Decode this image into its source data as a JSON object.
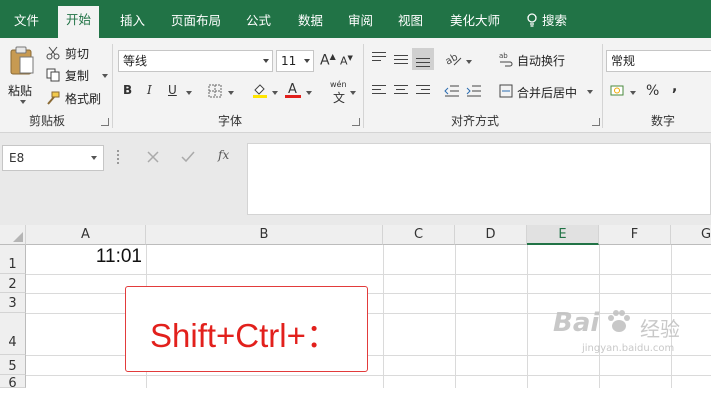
{
  "tabs": [
    "文件",
    "开始",
    "插入",
    "页面布局",
    "公式",
    "数据",
    "审阅",
    "视图",
    "美化大师"
  ],
  "search_label": "搜索",
  "clipboard": {
    "paste": "粘贴",
    "cut": "剪切",
    "copy": "复制",
    "format_painter": "格式刷",
    "group": "剪贴板"
  },
  "font": {
    "name": "等线",
    "size": "11",
    "bold": "B",
    "italic": "I",
    "underline": "U",
    "grow": "A",
    "shrink": "A",
    "color_a": "A",
    "wen": "wén",
    "wen_char": "文",
    "group": "字体"
  },
  "alignment": {
    "wrap": "自动换行",
    "merge": "合并后居中",
    "group": "对齐方式"
  },
  "number": {
    "format": "常规",
    "percent": "%",
    "comma": ",",
    "group": "数字"
  },
  "formula_bar": {
    "name_box": "E8",
    "fx": "fx"
  },
  "columns": [
    "A",
    "B",
    "C",
    "D",
    "E",
    "F",
    "G"
  ],
  "rows": [
    "1",
    "2",
    "3",
    "4",
    "5",
    "6"
  ],
  "cells": {
    "a1": "11:01"
  },
  "callout": "Shift+Ctrl+：",
  "watermark": {
    "brand": "Bai",
    "brand2": "经验",
    "url": "jingyan.baidu.com"
  },
  "colors": {
    "excel_green": "#217346",
    "callout_red": "#e2201c"
  }
}
